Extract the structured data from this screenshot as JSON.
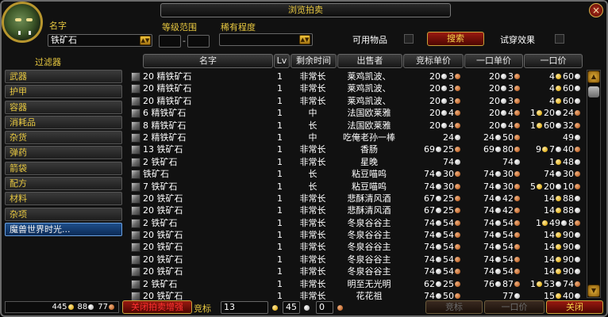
{
  "window": {
    "title": "浏览拍卖",
    "close": "×"
  },
  "search": {
    "name_label": "名字",
    "name_value": "铁矿石",
    "level_label": "等级范围",
    "level_dash": "-",
    "rarity_label": "稀有程度",
    "usable_label": "可用物品",
    "search_button": "搜索",
    "preview_label": "试穿效果"
  },
  "filters": {
    "header": "过滤器",
    "items": [
      "武器",
      "护甲",
      "容器",
      "消耗品",
      "杂货",
      "弹药",
      "箭袋",
      "配方",
      "材料",
      "杂项",
      "魔兽世界时光..."
    ],
    "active_index": 10
  },
  "columns": [
    "名字",
    "Lv",
    "剩余时间",
    "出售者",
    "竞标单价",
    "一口单价",
    "一口价"
  ],
  "coin_colors": {
    "gold": "#e0b020",
    "silver": "#c0c0c0",
    "copper": "#c06a30"
  },
  "rows": [
    {
      "name": "20 精铁矿石",
      "lv": "1",
      "time": "非常长",
      "seller": "莱鸡凯波、",
      "bid": [
        [
          "20",
          "s"
        ],
        [
          "3",
          "c"
        ]
      ],
      "unit": [
        [
          "20",
          "s"
        ],
        [
          "3",
          "c"
        ]
      ],
      "buy": [
        [
          "4",
          "g"
        ],
        [
          "60",
          "s"
        ]
      ]
    },
    {
      "name": "20 精铁矿石",
      "lv": "1",
      "time": "非常长",
      "seller": "莱鸡凯波、",
      "bid": [
        [
          "20",
          "s"
        ],
        [
          "3",
          "c"
        ]
      ],
      "unit": [
        [
          "20",
          "s"
        ],
        [
          "3",
          "c"
        ]
      ],
      "buy": [
        [
          "4",
          "g"
        ],
        [
          "60",
          "s"
        ]
      ]
    },
    {
      "name": "20 精铁矿石",
      "lv": "1",
      "time": "非常长",
      "seller": "莱鸡凯波、",
      "bid": [
        [
          "20",
          "s"
        ],
        [
          "3",
          "c"
        ]
      ],
      "unit": [
        [
          "20",
          "s"
        ],
        [
          "3",
          "c"
        ]
      ],
      "buy": [
        [
          "4",
          "g"
        ],
        [
          "60",
          "s"
        ]
      ]
    },
    {
      "name": "6 精铁矿石",
      "lv": "1",
      "time": "中",
      "seller": "法国欧莱雅",
      "bid": [
        [
          "20",
          "s"
        ],
        [
          "4",
          "c"
        ]
      ],
      "unit": [
        [
          "20",
          "s"
        ],
        [
          "4",
          "c"
        ]
      ],
      "buy": [
        [
          "1",
          "g"
        ],
        [
          "20",
          "s"
        ],
        [
          "24",
          "c"
        ]
      ]
    },
    {
      "name": "8 精铁矿石",
      "lv": "1",
      "time": "长",
      "seller": "法国欧莱雅",
      "bid": [
        [
          "20",
          "s"
        ],
        [
          "4",
          "c"
        ]
      ],
      "unit": [
        [
          "20",
          "s"
        ],
        [
          "4",
          "c"
        ]
      ],
      "buy": [
        [
          "1",
          "g"
        ],
        [
          "60",
          "s"
        ],
        [
          "32",
          "c"
        ]
      ]
    },
    {
      "name": "2 精铁矿石",
      "lv": "1",
      "time": "中",
      "seller": "吃俺老孙一棒",
      "bid": [
        [
          "24",
          "s"
        ]
      ],
      "unit": [
        [
          "24",
          "s"
        ],
        [
          "50",
          "c"
        ]
      ],
      "buy": [
        [
          "49",
          "s"
        ]
      ]
    },
    {
      "name": "13 铁矿石",
      "lv": "1",
      "time": "非常长",
      "seller": "香肠",
      "bid": [
        [
          "69",
          "s"
        ],
        [
          "25",
          "c"
        ]
      ],
      "unit": [
        [
          "69",
          "s"
        ],
        [
          "80",
          "c"
        ]
      ],
      "buy": [
        [
          "9",
          "g"
        ],
        [
          "7",
          "s"
        ],
        [
          "40",
          "c"
        ]
      ]
    },
    {
      "name": "2 铁矿石",
      "lv": "1",
      "time": "非常长",
      "seller": "星晚",
      "bid": [
        [
          "74",
          "s"
        ]
      ],
      "unit": [
        [
          "74",
          "s"
        ]
      ],
      "buy": [
        [
          "1",
          "g"
        ],
        [
          "48",
          "s"
        ]
      ]
    },
    {
      "name": "铁矿石",
      "lv": "1",
      "time": "长",
      "seller": "粘豆喵呜",
      "bid": [
        [
          "74",
          "s"
        ],
        [
          "30",
          "c"
        ]
      ],
      "unit": [
        [
          "74",
          "s"
        ],
        [
          "30",
          "c"
        ]
      ],
      "buy": [
        [
          "74",
          "s"
        ],
        [
          "30",
          "c"
        ]
      ]
    },
    {
      "name": "7 铁矿石",
      "lv": "1",
      "time": "长",
      "seller": "粘豆喵呜",
      "bid": [
        [
          "74",
          "s"
        ],
        [
          "30",
          "c"
        ]
      ],
      "unit": [
        [
          "74",
          "s"
        ],
        [
          "30",
          "c"
        ]
      ],
      "buy": [
        [
          "5",
          "g"
        ],
        [
          "20",
          "s"
        ],
        [
          "10",
          "c"
        ]
      ]
    },
    {
      "name": "20 铁矿石",
      "lv": "1",
      "time": "非常长",
      "seller": "悲酥清风酒",
      "bid": [
        [
          "67",
          "s"
        ],
        [
          "25",
          "c"
        ]
      ],
      "unit": [
        [
          "74",
          "s"
        ],
        [
          "42",
          "c"
        ]
      ],
      "buy": [
        [
          "14",
          "g"
        ],
        [
          "88",
          "s"
        ]
      ]
    },
    {
      "name": "20 铁矿石",
      "lv": "1",
      "time": "非常长",
      "seller": "悲酥清风酒",
      "bid": [
        [
          "67",
          "s"
        ],
        [
          "25",
          "c"
        ]
      ],
      "unit": [
        [
          "74",
          "s"
        ],
        [
          "42",
          "c"
        ]
      ],
      "buy": [
        [
          "14",
          "g"
        ],
        [
          "88",
          "s"
        ]
      ]
    },
    {
      "name": "2 铁矿石",
      "lv": "1",
      "time": "非常长",
      "seller": "冬泉谷谷主",
      "bid": [
        [
          "74",
          "s"
        ],
        [
          "54",
          "c"
        ]
      ],
      "unit": [
        [
          "74",
          "s"
        ],
        [
          "54",
          "c"
        ]
      ],
      "buy": [
        [
          "1",
          "g"
        ],
        [
          "49",
          "s"
        ],
        [
          "8",
          "c"
        ]
      ]
    },
    {
      "name": "20 铁矿石",
      "lv": "1",
      "time": "非常长",
      "seller": "冬泉谷谷主",
      "bid": [
        [
          "74",
          "s"
        ],
        [
          "54",
          "c"
        ]
      ],
      "unit": [
        [
          "74",
          "s"
        ],
        [
          "54",
          "c"
        ]
      ],
      "buy": [
        [
          "14",
          "g"
        ],
        [
          "90",
          "s"
        ]
      ]
    },
    {
      "name": "20 铁矿石",
      "lv": "1",
      "time": "非常长",
      "seller": "冬泉谷谷主",
      "bid": [
        [
          "74",
          "s"
        ],
        [
          "54",
          "c"
        ]
      ],
      "unit": [
        [
          "74",
          "s"
        ],
        [
          "54",
          "c"
        ]
      ],
      "buy": [
        [
          "14",
          "g"
        ],
        [
          "90",
          "s"
        ]
      ]
    },
    {
      "name": "20 铁矿石",
      "lv": "1",
      "time": "非常长",
      "seller": "冬泉谷谷主",
      "bid": [
        [
          "74",
          "s"
        ],
        [
          "54",
          "c"
        ]
      ],
      "unit": [
        [
          "74",
          "s"
        ],
        [
          "54",
          "c"
        ]
      ],
      "buy": [
        [
          "14",
          "g"
        ],
        [
          "90",
          "s"
        ]
      ]
    },
    {
      "name": "20 铁矿石",
      "lv": "1",
      "time": "非常长",
      "seller": "冬泉谷谷主",
      "bid": [
        [
          "74",
          "s"
        ],
        [
          "54",
          "c"
        ]
      ],
      "unit": [
        [
          "74",
          "s"
        ],
        [
          "54",
          "c"
        ]
      ],
      "buy": [
        [
          "14",
          "g"
        ],
        [
          "90",
          "s"
        ]
      ]
    },
    {
      "name": "2 铁矿石",
      "lv": "1",
      "time": "非常长",
      "seller": "明至无光明",
      "bid": [
        [
          "62",
          "s"
        ],
        [
          "25",
          "c"
        ]
      ],
      "unit": [
        [
          "76",
          "s"
        ],
        [
          "87",
          "c"
        ]
      ],
      "buy": [
        [
          "1",
          "g"
        ],
        [
          "53",
          "s"
        ],
        [
          "74",
          "c"
        ]
      ]
    },
    {
      "name": "20 铁矿石",
      "lv": "1",
      "time": "非常长",
      "seller": "花花祖",
      "bid": [
        [
          "74",
          "s"
        ],
        [
          "50",
          "c"
        ]
      ],
      "unit": [
        [
          "77",
          "s"
        ]
      ],
      "buy": [
        [
          "15",
          "g"
        ],
        [
          "40",
          "s"
        ]
      ]
    }
  ],
  "bottom": {
    "gold": "445",
    "silver": "88",
    "copper": "77",
    "close_enh_label": "关闭拍卖增强",
    "bid_label": "竞标",
    "bid_gold": "13",
    "bid_silver": "45",
    "bid_copper": "0",
    "bid_button": "竞标",
    "buyout_button": "一口价",
    "close_button": "关闭"
  }
}
